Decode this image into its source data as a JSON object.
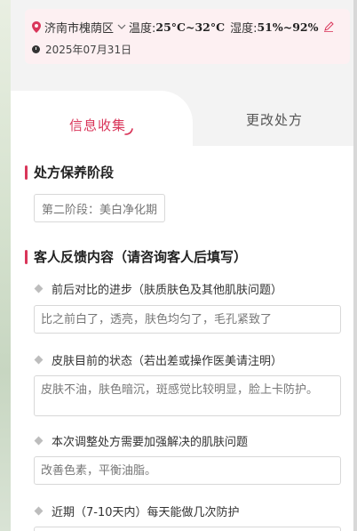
{
  "location": {
    "city": "济南市槐荫区",
    "temp_label": "温度:",
    "temp_value": "25°C~32°C",
    "humidity_label": "湿度:",
    "humidity_value": "51%~92%",
    "date": "2025年07月31日"
  },
  "tabs": [
    {
      "label": "信息收集",
      "active": true
    },
    {
      "label": "更改处方",
      "active": false
    }
  ],
  "section_stage": {
    "title": "处方保养阶段",
    "value": "第二阶段：美白净化期"
  },
  "section_feedback": {
    "title": "客人反馈内容（请咨询客人后填写）",
    "questions": [
      {
        "label": "前后对比的进步（肤质肤色及其他肌肤问题）",
        "answer": "比之前白了，透亮，肤色均匀了，毛孔紧致了"
      },
      {
        "label": "皮肤目前的状态（若出差或操作医美请注明）",
        "answer": "皮肤不油，肤色暗沉，斑感觉比较明显，脸上卡防护。"
      },
      {
        "label": "本次调整处方需要加强解决的肌肤问题",
        "answer": "改善色素，平衡油脂。"
      },
      {
        "label": "近期（7-10天内）每天能做几次防护",
        "answer": ""
      }
    ]
  },
  "colors": {
    "accent": "#d9365a",
    "info_bg": "#fdf0f2"
  }
}
